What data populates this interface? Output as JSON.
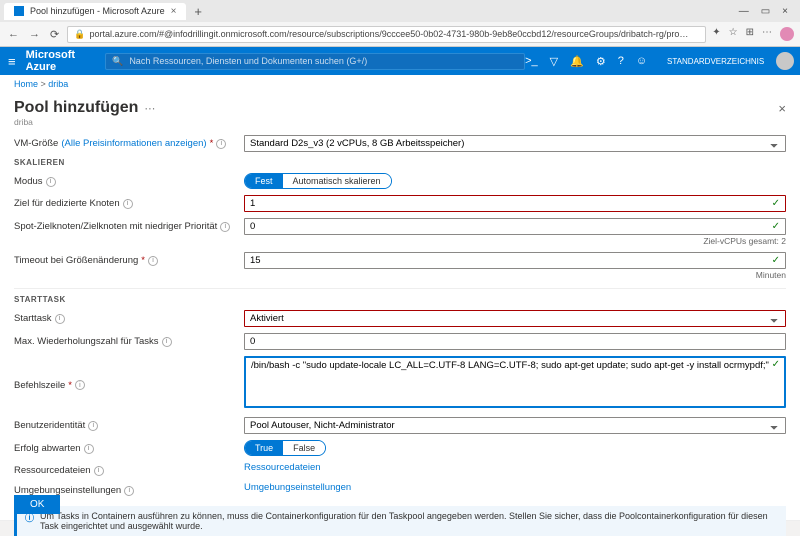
{
  "browser": {
    "tab_title": "Pool hinzufügen - Microsoft Azure",
    "url": "portal.azure.com/#@infodrillingit.onmicrosoft.com/resource/subscriptions/9cccee50-0b02-4731-980b-9eb8e0ccbd12/resourceGroups/dribatch-rg/pro…"
  },
  "azure_header": {
    "brand": "Microsoft Azure",
    "search_placeholder": "Nach Ressourcen, Diensten und Dokumenten suchen (G+/)",
    "directory": "STANDARDVERZEICHNIS"
  },
  "breadcrumbs": {
    "home": "Home",
    "sep": " > ",
    "current": "driba"
  },
  "blade": {
    "title": "Pool hinzufügen",
    "subtitle": "driba"
  },
  "form": {
    "vm_size_label": "VM-Größe",
    "vm_size_link": "(Alle Preisinformationen anzeigen)",
    "vm_size_value": "Standard D2s_v3 (2 vCPUs, 8 GB Arbeitsspeicher)",
    "sec_scale": "SKALIEREN",
    "mode_label": "Modus",
    "mode_fixed": "Fest",
    "mode_auto": "Automatisch skalieren",
    "dedicated_label": "Ziel für dedizierte Knoten",
    "dedicated_value": "1",
    "spot_label": "Spot-Zielknoten/Zielknoten mit niedriger Priorität",
    "spot_value": "0",
    "vcpu_hint": "Ziel-vCPUs gesamt: 2",
    "timeout_label": "Timeout bei Größenänderung",
    "timeout_value": "15",
    "timeout_hint": "Minuten",
    "sec_start": "STARTTASK",
    "starttask_label": "Starttask",
    "starttask_value": "Aktiviert",
    "retry_label": "Max. Wiederholungszahl für Tasks",
    "retry_value": "0",
    "cmd_label": "Befehlszeile",
    "cmd_value": "/bin/bash -c \"sudo update-locale LC_ALL=C.UTF-8 LANG=C.UTF-8; sudo apt-get update; sudo apt-get -y install ocrmypdf;\"",
    "user_label": "Benutzeridentität",
    "user_value": "Pool Autouser, Nicht-Administrator",
    "wait_label": "Erfolg abwarten",
    "wait_true": "True",
    "wait_false": "False",
    "resfiles_label": "Ressourcedateien",
    "resfiles_link": "Ressourcedateien",
    "env_label": "Umgebungseinstellungen",
    "env_link": "Umgebungseinstellungen",
    "info_msg": "Um Tasks in Containern ausführen zu können, muss die Containerkonfiguration für den Taskpool angegeben werden. Stellen Sie sicher, dass die Poolcontainerkonfiguration für diesen Task eingerichtet und ausgewählt wurde.",
    "ok": "OK"
  }
}
